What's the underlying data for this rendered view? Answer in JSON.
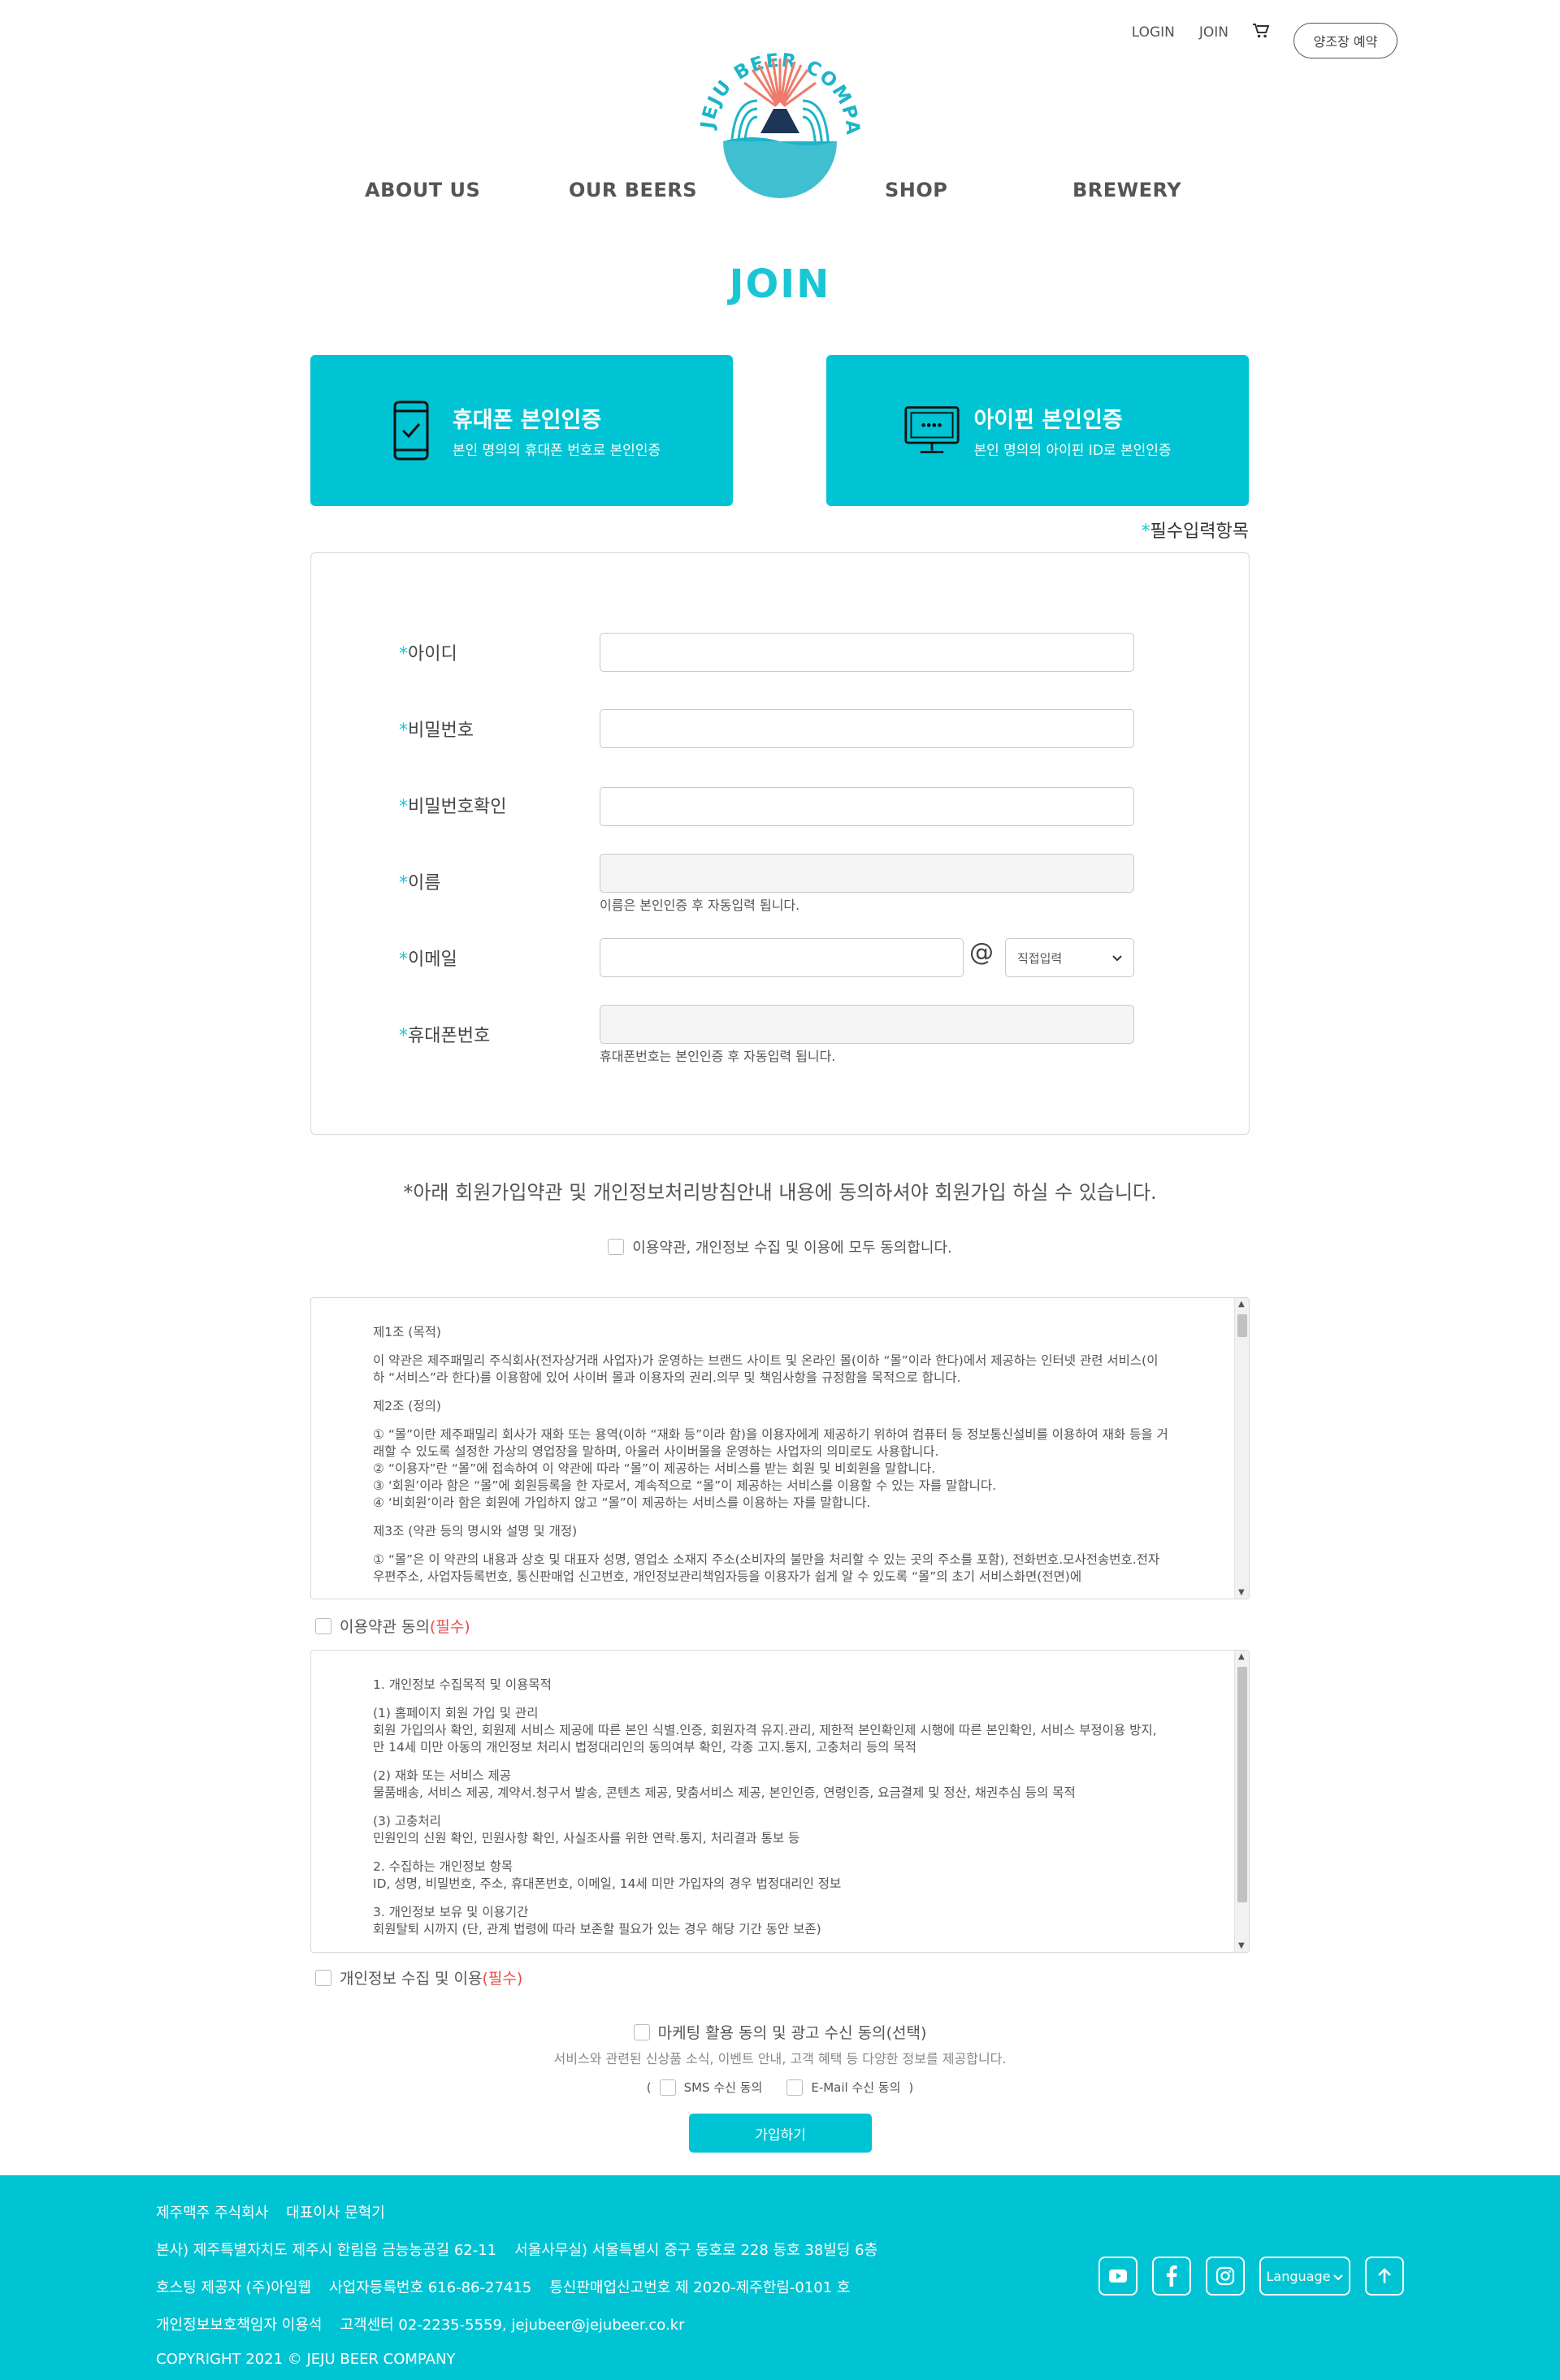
{
  "header": {
    "util": {
      "login": "LOGIN",
      "join": "JOIN",
      "cart_icon": "cart-icon"
    },
    "reserve_button": "양조장 예약",
    "logo_text": "JEJU BEER COMPANY",
    "nav": [
      "ABOUT US",
      "OUR BEERS",
      "SHOP",
      "BREWERY"
    ]
  },
  "page_title": "JOIN",
  "verification": [
    {
      "icon": "smartphone-check-icon",
      "title": "휴대폰 본인인증",
      "desc": "본인 명의의 휴대폰 번호로 본인인증"
    },
    {
      "icon": "monitor-pin-icon",
      "title": "아이핀 본인인증",
      "desc": "본인 명의의 아이핀 ID로 본인인증"
    }
  ],
  "required_note": {
    "star": "*",
    "text": "필수입력항목"
  },
  "form": {
    "id_label": "아이디",
    "pw_label": "비밀번호",
    "pw_confirm_label": "비밀번호확인",
    "name_label": "이름",
    "name_help": "이름은 본인인증 후 자동입력 됩니다.",
    "email_label": "이메일",
    "email_at": "@",
    "email_domain_select": "직접입력",
    "phone_label": "휴대폰번호",
    "phone_help": "휴대폰번호는 본인인증 후 자동입력 됩니다."
  },
  "agreement": {
    "notice": "*아래 회원가입약관 및 개인정보처리방침안내 내용에 동의하셔야 회원가입 하실 수 있습니다.",
    "all_agree": "이용약관, 개인정보 수집 및 이용에 모두 동의합니다.",
    "terms1": {
      "paragraphs": [
        "제1조 (목적)",
        "이 약관은 제주패밀리 주식회사(전자상거래 사업자)가 운영하는 브랜드 사이트 및 온라인 몰(이하 “몰”이라 한다)에서 제공하는 인터넷 관련 서비스(이하 “서비스”라 한다)를 이용함에 있어 사이버 몰과 이용자의 권리.의무 및 책임사항을 규정함을 목적으로 합니다.",
        "제2조 (정의)",
        "① “몰”이란 제주패밀리 회사가 재화 또는 용역(이하 “재화 등”이라 함)을 이용자에게 제공하기 위하여 컴퓨터 등 정보통신설비를 이용하여 재화 등을 거래할 수 있도록 설정한 가상의 영업장을 말하며, 아울러 사이버몰을 운영하는 사업자의 의미로도 사용합니다.\n② “이용자”란 “몰”에 접속하여 이 약관에 따라 “몰”이 제공하는 서비스를 받는 회원 및 비회원을 말합니다.\n③ ‘회원’이라 함은 “몰”에 회원등록을 한 자로서, 계속적으로 “몰”이 제공하는 서비스를 이용할 수 있는 자를 말합니다.\n④ ‘비회원’이라 함은 회원에 가입하지 않고 “몰”이 제공하는 서비스를 이용하는 자를 말합니다.",
        "제3조 (약관 등의 명시와 설명 및 개정)",
        "① “몰”은 이 약관의 내용과 상호 및 대표자 성명, 영업소 소재지 주소(소비자의 불만을 처리할 수 있는 곳의 주소를 포함), 전화번호.모사전송번호.전자우편주소, 사업자등록번호, 통신판매업 신고번호, 개인정보관리책임자등을 이용자가 쉽게 알 수 있도록 “몰”의 초기 서비스화면(전면)에"
      ],
      "agree_label": "이용약관 동의",
      "required": "(필수)"
    },
    "terms2": {
      "paragraphs": [
        "1. 개인정보 수집목적 및 이용목적",
        "(1) 홈페이지 회원 가입 및 관리\n회원 가입의사 확인, 회원제 서비스 제공에 따른 본인 식별.인증, 회원자격 유지.관리, 제한적 본인확인제 시행에 따른 본인확인, 서비스 부정이용 방지, 만 14세 미만 아동의 개인정보 처리시 법정대리인의 동의여부 확인, 각종 고지.통지, 고충처리 등의 목적",
        "(2) 재화 또는 서비스 제공\n물품배송, 서비스 제공, 계약서.청구서 발송, 콘텐츠 제공, 맞춤서비스 제공, 본인인증, 연령인증, 요금결제 및 정산, 채권추심 등의 목적",
        "(3) 고충처리\n민원인의 신원 확인, 민원사항 확인, 사실조사를 위한 연락.통지, 처리결과 통보 등",
        "2. 수집하는 개인정보 항목\nID, 성명, 비밀번호, 주소, 휴대폰번호, 이메일, 14세 미만 가입자의 경우 법정대리인 정보",
        "3. 개인정보 보유 및 이용기간\n회원탈퇴 시까지 (단, 관계 법령에 따라 보존할 필요가 있는 경우 해당 기간 동안 보존)"
      ],
      "agree_label": "개인정보 수집 및 이용",
      "required": "(필수)"
    },
    "marketing": {
      "label": "마케팅 활용 동의 및 광고 수신 동의(선택)",
      "desc": "서비스와 관련된 신상품 소식, 이벤트 안내, 고객 혜택 등 다양한 정보를 제공합니다.",
      "open": "(",
      "sms": "SMS 수신 동의",
      "email": "E-Mail 수신 동의",
      "close": ")"
    }
  },
  "submit": "가입하기",
  "footer": {
    "company": "제주맥주 주식회사",
    "ceo": "대표이사 문혁기",
    "hq": "본사) 제주특별자치도 제주시 한림읍 금능농공길 62-11",
    "seoul": "서울사무실) 서울특별시 중구 동호로 228 동호 38빌딩 6층",
    "hosting": "호스팅 제공자 (주)아임웹",
    "bizno": "사업자등록번호 616-86-27415",
    "mailorder": "통신판매업신고번호 제 2020-제주한림-0101 호",
    "privacy": "개인정보보호책임자 이용석",
    "cs": "고객센터 02-2235-5559, jejubeer@jejubeer.co.kr",
    "copyright": "COPYRIGHT 2021 © JEJU BEER COMPANY",
    "language": "Language",
    "social_icons": [
      "youtube-icon",
      "facebook-icon",
      "instagram-icon"
    ],
    "top_icon": "arrow-up-icon"
  },
  "colors": {
    "brand": "#00c4d4",
    "required": "#e84b4b",
    "logo_coral": "#ee7b6b"
  }
}
